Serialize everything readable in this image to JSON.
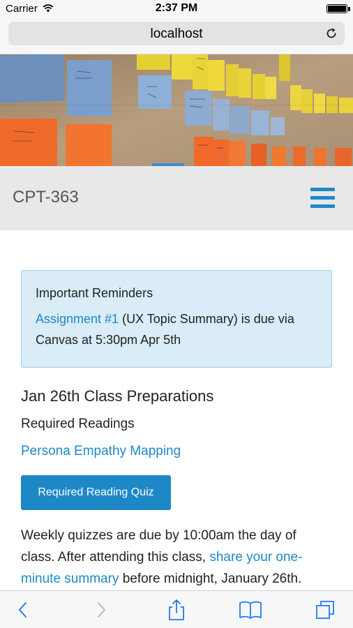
{
  "status_bar": {
    "carrier": "Carrier",
    "time": "2:37 PM"
  },
  "browser": {
    "url": "localhost"
  },
  "site": {
    "brand": "CPT-363"
  },
  "reminder": {
    "title": "Important Reminders",
    "link_text": "Assignment #1",
    "text_after_link": " (UX Topic Summary) is due via Canvas at 5:30pm Apr 5th"
  },
  "main": {
    "heading": "Jan 26th Class Preparations",
    "subheading": "Required Readings",
    "reading_link": "Persona Empathy Mapping",
    "quiz_button": "Required Reading Quiz",
    "para_text_1": "Weekly quizzes are due by 10:00am the day of class. After attending this class, ",
    "para_link": "share your one-minute summary",
    "para_text_2": " before midnight, January 26th."
  },
  "colors": {
    "accent": "#1e88c7",
    "header_bg": "#e8e8e8",
    "reminder_bg": "#d9ecf7"
  }
}
